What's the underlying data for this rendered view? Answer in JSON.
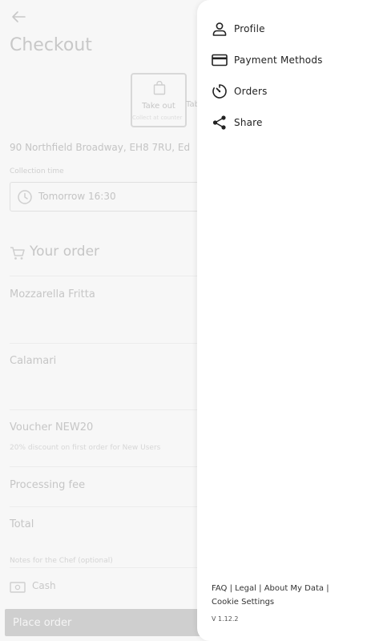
{
  "checkout": {
    "title": "Checkout",
    "takeout_label": "Take out",
    "takeout_subtitle": "Collect at counter",
    "table_label": "Tab",
    "address": "90 Northfield Broadway, EH8 7RU, Ed",
    "collection_label": "Collection time",
    "collection_time": "Tomorrow 16:30",
    "order_heading": "Your order",
    "items": [
      {
        "name": "Mozzarella Fritta"
      },
      {
        "name": "Calamari"
      },
      {
        "name": "Voucher NEW20",
        "description": "20% discount on first order for New Users"
      },
      {
        "name": "Processing fee"
      },
      {
        "name": "Total"
      }
    ],
    "notes_label": "Notes for the Chef (optional)",
    "payment_method": "Cash",
    "place_order_label": "Place order"
  },
  "drawer": {
    "menu": [
      {
        "label": "Profile",
        "icon": "person-icon"
      },
      {
        "label": "Payment Methods",
        "icon": "credit-card-icon"
      },
      {
        "label": "Orders",
        "icon": "timer-icon"
      },
      {
        "label": "Share",
        "icon": "share-icon"
      }
    ],
    "footer": {
      "faq": "FAQ",
      "legal": "Legal",
      "about": "About My Data",
      "cookies": "Cookie Settings",
      "separator": "|"
    },
    "version": "V 1.12.2"
  },
  "colors": {
    "dim_text": "#c6c6c6",
    "drawer_bg": "#ffffff",
    "menu_text": "#222222",
    "button_disabled": "#cfcfcf"
  }
}
